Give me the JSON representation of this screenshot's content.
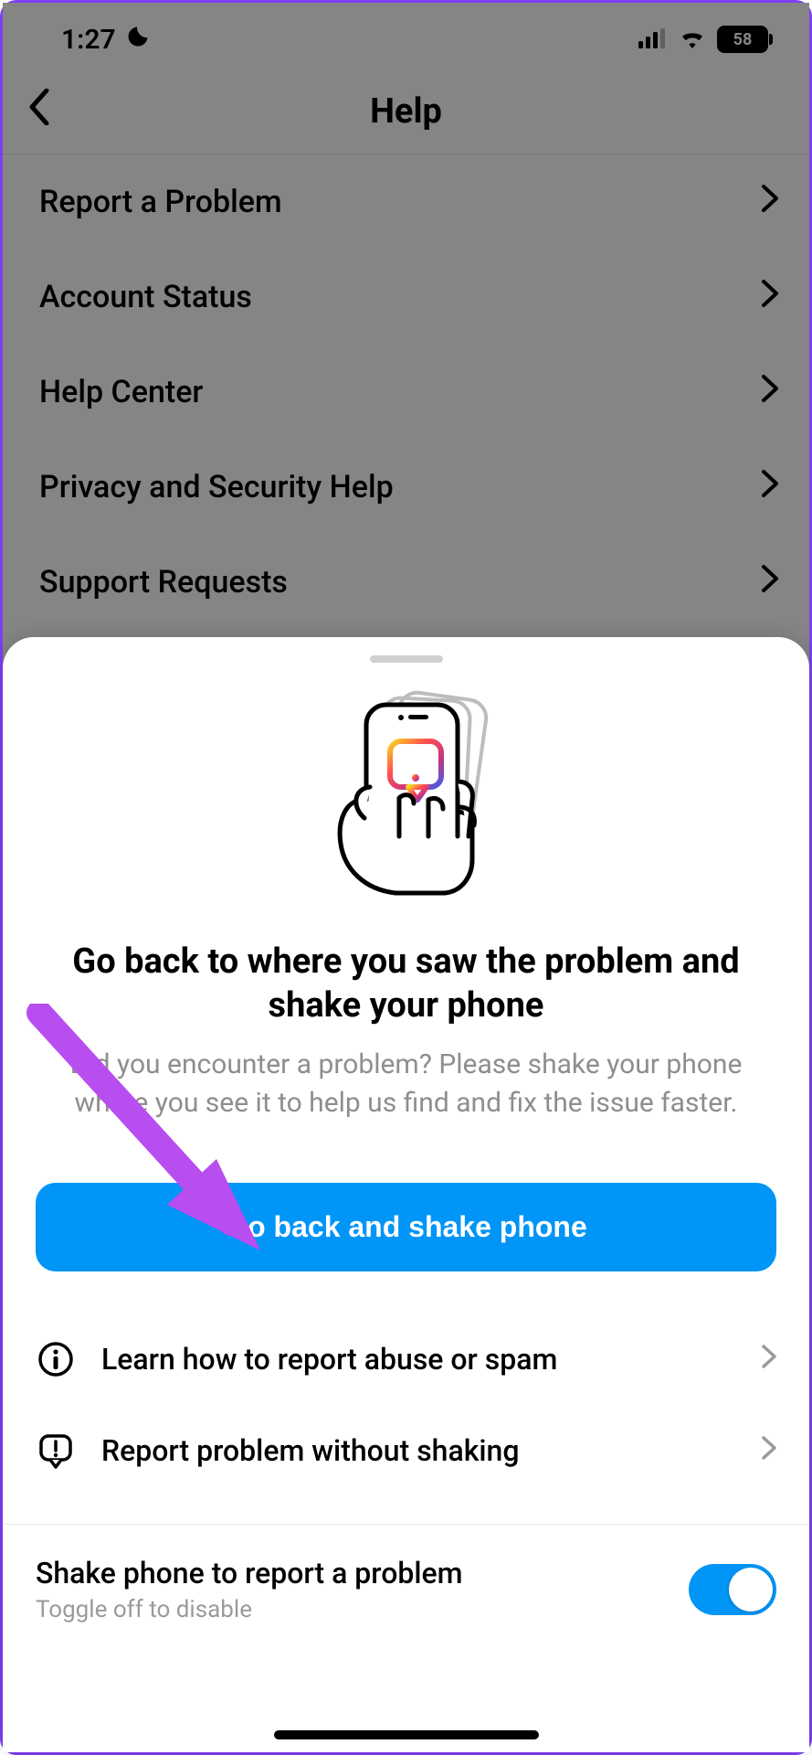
{
  "status_bar": {
    "time": "1:27",
    "battery": "58"
  },
  "header": {
    "title": "Help"
  },
  "help_items": [
    {
      "label": "Report a Problem"
    },
    {
      "label": "Account Status"
    },
    {
      "label": "Help Center"
    },
    {
      "label": "Privacy and Security Help"
    },
    {
      "label": "Support Requests"
    }
  ],
  "sheet": {
    "title": "Go back to where you saw the problem and shake your phone",
    "subtitle": "Did you encounter a problem? Please shake your phone where you see it to help us find and fix the issue faster.",
    "primary_button": "Go back and shake phone",
    "options": [
      {
        "label": "Learn how to report abuse or spam"
      },
      {
        "label": "Report problem without shaking"
      }
    ],
    "toggle": {
      "title": "Shake phone to report a problem",
      "hint": "Toggle off to disable",
      "on": true
    }
  }
}
